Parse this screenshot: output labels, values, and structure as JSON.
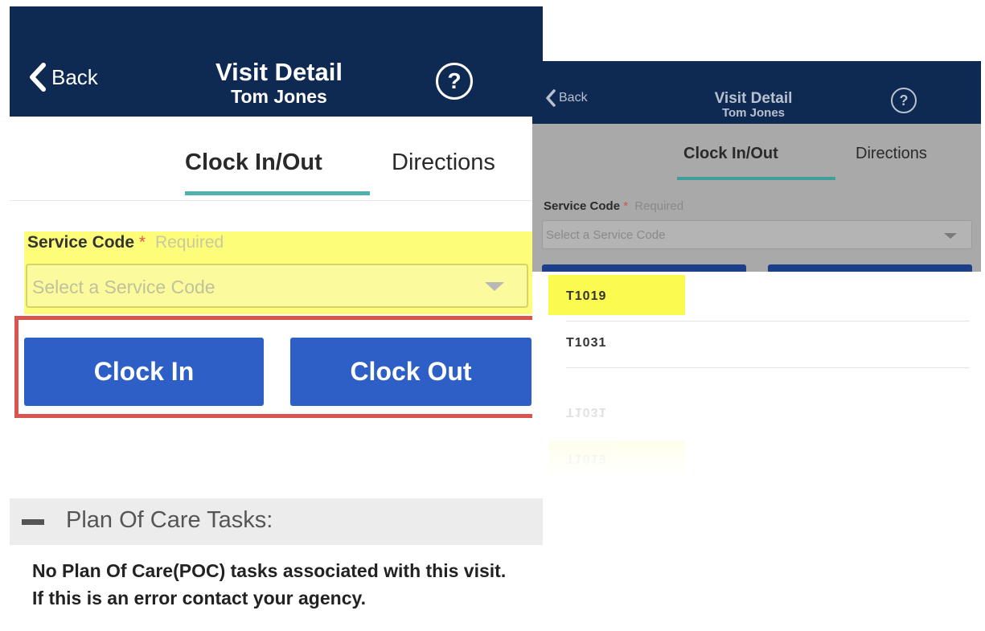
{
  "left_screen": {
    "header": {
      "back_label": "Back",
      "title": "Visit Detail",
      "subtitle": "Tom Jones",
      "help_glyph": "?"
    },
    "tabs": [
      {
        "label": "Clock In/Out",
        "active": true
      },
      {
        "label": "Directions",
        "active": false
      }
    ],
    "service_code": {
      "label": "Service Code",
      "required_marker": "*",
      "required_text": "Required",
      "placeholder": "Select a Service Code"
    },
    "buttons": {
      "clock_in": "Clock In",
      "clock_out": "Clock Out"
    },
    "plan_of_care": {
      "header": "Plan Of Care Tasks:",
      "message": "No Plan Of Care(POC) tasks associated with this visit. If this is an error contact your agency."
    }
  },
  "right_screen": {
    "header": {
      "back_label": "Back",
      "title": "Visit Detail",
      "subtitle": "Tom Jones",
      "help_glyph": "?"
    },
    "tabs": [
      {
        "label": "Clock In/Out",
        "active": true
      },
      {
        "label": "Directions",
        "active": false
      }
    ],
    "service_code": {
      "label": "Service Code",
      "required_marker": "*",
      "required_text": "Required",
      "placeholder": "Select a Service Code"
    },
    "dropdown_options": [
      {
        "code": "T1019",
        "highlighted": true
      },
      {
        "code": "T1031",
        "highlighted": false
      }
    ]
  },
  "colors": {
    "header_bg": "#0f2a52",
    "button_bg": "#2d5fc6",
    "tab_underline": "#4fb1ad",
    "highlight_yellow": "#fdfd7a",
    "callout_red": "#d9534f"
  },
  "icons": {
    "back": "chevron-left-icon",
    "help": "help-circle-icon",
    "select_caret": "caret-down-icon",
    "collapse": "minus-icon"
  }
}
